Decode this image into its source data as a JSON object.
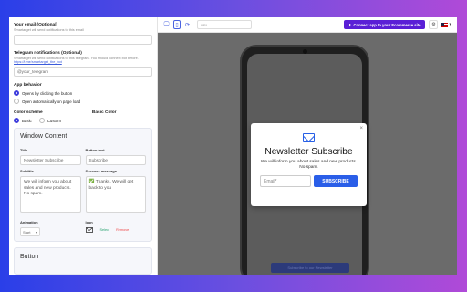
{
  "settings": {
    "email": {
      "label": "Your email (Optional)",
      "hint": "Smartarget will send notifications to this email",
      "value": ""
    },
    "telegram": {
      "label": "Telegram notifications (Optional)",
      "hint": "Smartarget will send notifications to this telegram. You should connect bot before.",
      "link": "https://t.me/smartarget_the_bot",
      "placeholder": "@your_telegram"
    },
    "behavior": {
      "label": "App behavior",
      "option1": "Opens by clicking the button",
      "option2": "Open automatically on page load"
    },
    "scheme": {
      "label": "Color scheme",
      "basic_label": "Basic Color",
      "opt_basic": "Basic",
      "opt_custom": "Custom"
    },
    "window": {
      "title": "Window Content",
      "title_label": "Title",
      "title_value": "Newsletter Subscribe",
      "button_label": "Button text",
      "button_value": "Subscribe",
      "subtitle_label": "Subtitle",
      "subtitle_value": "We will inform you about sales and new products. No spam.",
      "success_label": "Success message",
      "success_value": "✅ Thanks. We will get back to you",
      "animation_label": "Animation",
      "animation_value": "Start",
      "icon_label": "Icon",
      "select_link": "Select",
      "remove_link": "Remove"
    },
    "button_section": {
      "title": "Button"
    }
  },
  "toolbar": {
    "url_placeholder": "URL",
    "connect_label": "Connect app to your Ecommerce site"
  },
  "popup": {
    "title": "Newsletter Subscribe",
    "subtitle": "We will inform you about sales and new products. No spam.",
    "email_placeholder": "Email*",
    "button": "SUBSCRIBE",
    "close": "×"
  },
  "phone": {
    "ghost_button": "Subscribe to our Newsletter"
  },
  "colors": {
    "accent": "#3d3bdc",
    "connect": "#5a1fd6",
    "popup_button": "#2a5ee8"
  }
}
